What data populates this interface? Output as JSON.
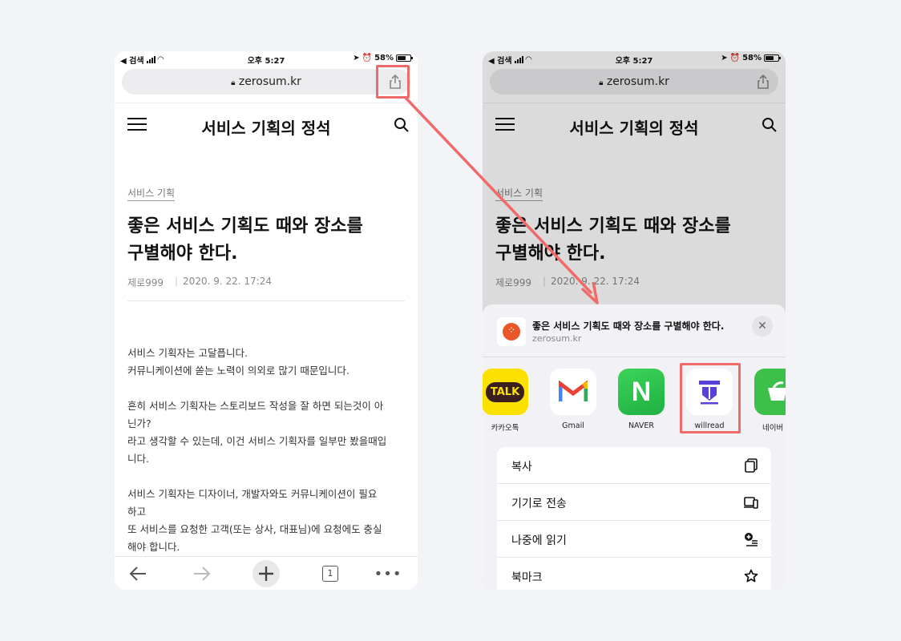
{
  "colors": {
    "background": "#f3f4f8",
    "highlight": "#f06a6a",
    "kakao": "#fae100",
    "naver": "#2db400",
    "willread": "#5a3fd8"
  },
  "status_bar": {
    "back_app": "◀ 검색",
    "time": "오후 5:27",
    "battery": "58%"
  },
  "browser": {
    "url": "zerosum.kr",
    "share_icon": "share-icon",
    "lock_icon": "lock-icon"
  },
  "site": {
    "title": "서비스 기획의 정석"
  },
  "article": {
    "category": "서비스 기획",
    "title_lines": [
      "좋은 서비스 기획도 때와 장소를",
      "구별해야 한다."
    ],
    "author": "제로999",
    "date": "2020. 9. 22. 17:24",
    "paragraphs": [
      [
        "서비스 기획자는 고달픕니다.",
        "커뮤니케이션에 쏟는 노력이 의외로 많기 때문입니다."
      ],
      [
        "흔히 서비스 기획자는 스토리보드 작성을 잘 하면 되는것이 아",
        "닌가?",
        "라고 생각할 수 있는데, 이건 서비스 기획자를 일부만 봤을때입",
        "니다."
      ],
      [
        "서비스 기획자는 디자이너, 개발자와도 커뮤니케이션이 필요",
        "하고",
        "또 서비스를 요청한 고객(또는 상사, 대표님)에 요청에도 충실",
        "해야 합니다."
      ]
    ]
  },
  "bottom_bar": {
    "tab_count": "1"
  },
  "share_sheet": {
    "title": "좋은 서비스 기획도 때와 장소를 구별해야 한다.",
    "subtitle": "zerosum.kr",
    "apps": [
      {
        "label": "카카오톡",
        "icon": "kakaotalk-icon",
        "icon_text": "TALK"
      },
      {
        "label": "Gmail",
        "icon": "gmail-icon",
        "icon_text": "M"
      },
      {
        "label": "NAVER",
        "icon": "naver-icon",
        "icon_text": "N"
      },
      {
        "label": "willread",
        "icon": "willread-icon",
        "icon_text": ""
      },
      {
        "label": "네이버 키",
        "icon": "naver-keep-icon",
        "icon_text": ""
      }
    ],
    "actions": [
      {
        "label": "복사",
        "icon": "copy-icon"
      },
      {
        "label": "기기로 전송",
        "icon": "send-to-device-icon"
      },
      {
        "label": "나중에 읽기",
        "icon": "read-later-icon"
      },
      {
        "label": "북마크",
        "icon": "bookmark-star-icon"
      }
    ]
  }
}
